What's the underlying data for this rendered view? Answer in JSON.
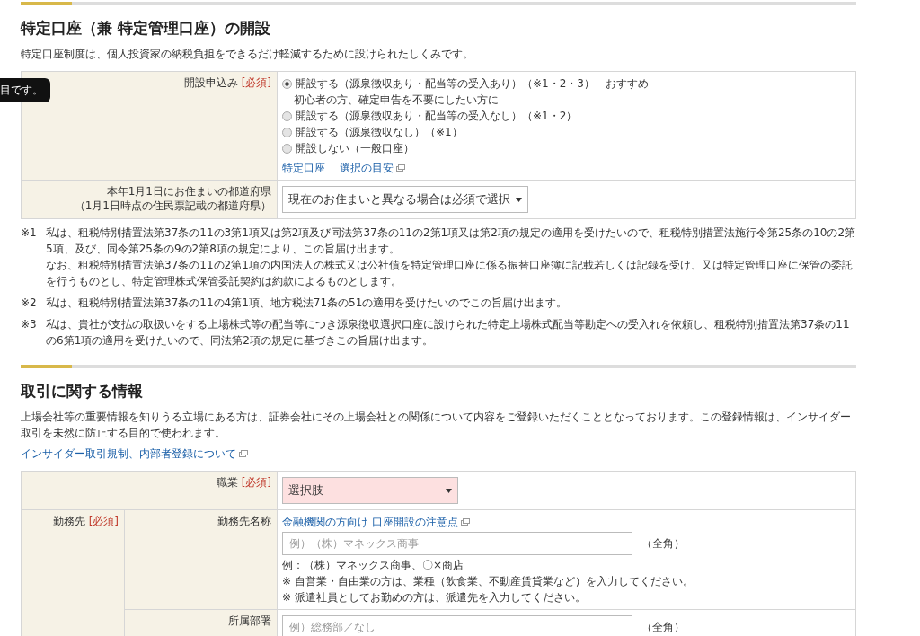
{
  "tooltip": {
    "text": "目です。"
  },
  "section1": {
    "title": "特定口座（兼 特定管理口座）の開設",
    "description": "特定口座制度は、個人投資家の納税負担をできるだけ軽減するために設けられたしくみです。",
    "application": {
      "label": "開設申込み",
      "required": "[必須]",
      "options": [
        {
          "label": "開設する（源泉徴収あり・配当等の受入あり）（※1・2・3）",
          "badge": "おすすめ",
          "note": "初心者の方、確定申告を不要にしたい方に",
          "selected": true
        },
        {
          "label": "開設する（源泉徴収あり・配当等の受入なし）（※1・2）",
          "selected": false
        },
        {
          "label": "開設する（源泉徴収なし）（※1）",
          "selected": false
        },
        {
          "label": "開設しない（一般口座）",
          "selected": false
        }
      ],
      "links": [
        "特定口座",
        "選択の目安"
      ]
    },
    "prefecture": {
      "label_lines": [
        "本年1月1日にお住まいの都道府県",
        "（1月1日時点の住民票記載の都道府県）"
      ],
      "select": "現在のお住まいと異なる場合は必須で選択"
    }
  },
  "notes": [
    {
      "mark": "※1",
      "paragraphs": [
        "私は、租税特別措置法第37条の11の3第1項又は第2項及び同法第37条の11の2第1項又は第2項の規定の適用を受けたいので、租税特別措置法施行令第25条の10の2第5項、及び、同令第25条の9の2第8項の規定により、この旨届け出ます。",
        "なお、租税特別措置法第37条の11の2第1項の内国法人の株式又は公社債を特定管理口座に係る振替口座簿に記載若しくは記録を受け、又は特定管理口座に保管の委託を行うものとし、特定管理株式保管委託契約は約款によるものとします。"
      ]
    },
    {
      "mark": "※2",
      "paragraphs": [
        "私は、租税特別措置法第37条の11の4第1項、地方税法71条の51の適用を受けたいのでこの旨届け出ます。"
      ]
    },
    {
      "mark": "※3",
      "paragraphs": [
        "私は、貴社が支払の取扱いをする上場株式等の配当等につき源泉徴収選択口座に設けられた特定上場株式配当等勘定への受入れを依頼し、租税特別措置法第37条の11の6第1項の適用を受けたいので、同法第2項の規定に基づきこの旨届け出ます。"
      ]
    }
  ],
  "section2": {
    "title": "取引に関する情報",
    "description": "上場会社等の重要情報を知りうる立場にある方は、証券会社にその上場会社との関係について内容をご登録いただくこととなっております。この登録情報は、インサイダー取引を未然に防止する目的で使われます。",
    "link": "インサイダー取引規制、内部者登録について",
    "occupation": {
      "label": "職業",
      "required": "[必須]",
      "select": "選択肢",
      "invalid": true
    },
    "workplace": {
      "label": "勤務先",
      "required": "[必須]",
      "fields": [
        {
          "label": "勤務先名称",
          "link": "金融機関の方向け 口座開設の注意点",
          "placeholder": "例）（株）マネックス商事",
          "suffix": "（全角）",
          "hints": [
            "例：（株）マネックス商事、〇×商店",
            "※ 自営業・自由業の方は、業種（飲食業、不動産賃貸業など）を入力してください。",
            "※ 派遣社員としてお勤めの方は、派遣先を入力してください。"
          ]
        },
        {
          "label": "所属部署",
          "placeholder": "例）総務部／なし",
          "suffix": "（全角）"
        }
      ]
    }
  }
}
